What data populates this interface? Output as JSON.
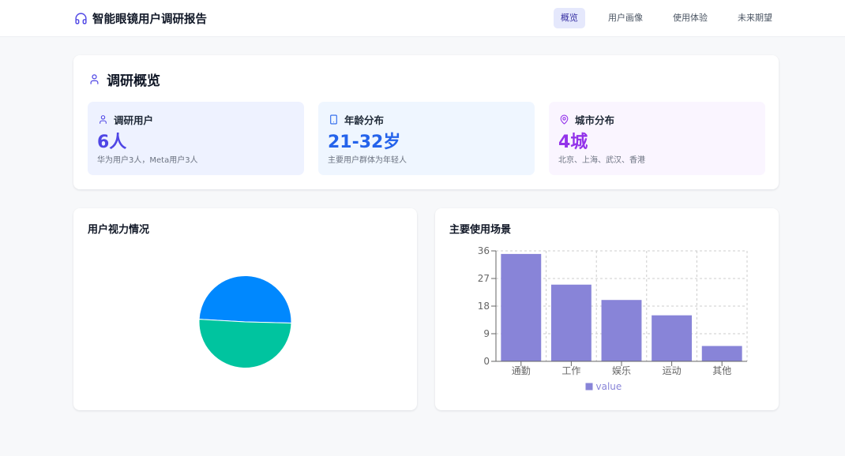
{
  "header": {
    "title": "智能眼镜用户调研报告",
    "logo_icon": "headphones-icon",
    "nav": [
      {
        "label": "概览",
        "active": true
      },
      {
        "label": "用户画像",
        "active": false
      },
      {
        "label": "使用体验",
        "active": false
      },
      {
        "label": "未来期望",
        "active": false
      }
    ]
  },
  "overview": {
    "title": "调研概览",
    "icon": "user-icon",
    "stats": [
      {
        "label": "调研用户",
        "value": "6人",
        "note": "华为用户3人，Meta用户3人",
        "icon": "user-icon",
        "color": "#4F46E5",
        "bg": "#EEF2FF"
      },
      {
        "label": "年龄分布",
        "value": "21-32岁",
        "note": "主要用户群体为年轻人",
        "icon": "smartphone-icon",
        "color": "#2563EB",
        "bg": "#EFF6FF"
      },
      {
        "label": "城市分布",
        "value": "4城",
        "note": "北京、上海、武汉、香港",
        "icon": "map-pin-icon",
        "color": "#9333EA",
        "bg": "#FAF5FF"
      }
    ]
  },
  "colors": {
    "accent": "#4F46E5",
    "nav_active_bg": "#E5E8FC",
    "page_bg": "#F7F8FA"
  },
  "chart_data": [
    {
      "type": "pie",
      "title": "用户视力情况",
      "values": [
        49.5,
        50.5
      ],
      "colors": [
        "#0088FE",
        "#00C49F"
      ]
    },
    {
      "type": "bar",
      "title": "主要使用场景",
      "categories": [
        "通勤",
        "工作",
        "娱乐",
        "运动",
        "其他"
      ],
      "series": [
        {
          "name": "value",
          "values": [
            35,
            25,
            20,
            15,
            5
          ],
          "color": "#8884D8"
        }
      ],
      "ylim": [
        0,
        36
      ],
      "yticks": [
        0,
        9,
        18,
        27,
        36
      ],
      "grid": true,
      "legend": "bottom"
    }
  ]
}
